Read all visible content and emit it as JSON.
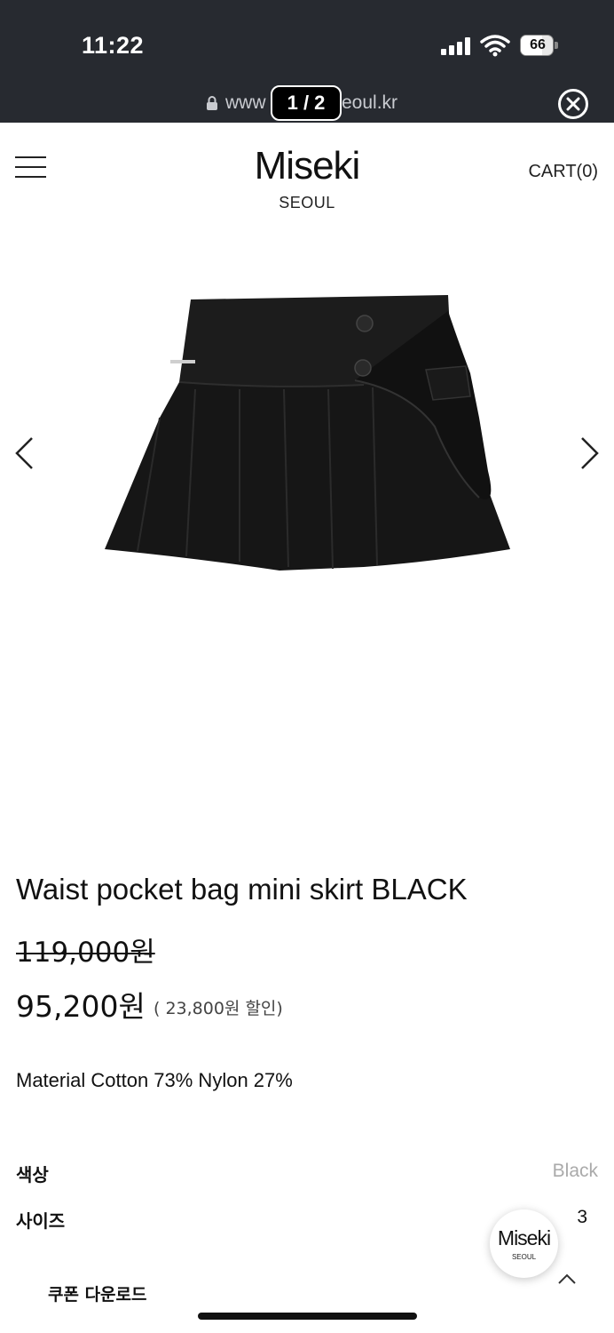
{
  "status_bar": {
    "time": "11:22",
    "battery": "66",
    "battery_level": 0.66
  },
  "browser": {
    "url_left": "www",
    "url_right": "eoul.kr",
    "page_counter": "1 / 2"
  },
  "header": {
    "brand": "Miseki",
    "brand_sub": "SEOUL",
    "cart": "CART(0)"
  },
  "product": {
    "title": "Waist pocket bag mini skirt BLACK",
    "original_price": "119,000원",
    "sale_price": "95,200원",
    "discount": "( 23,800원 할인)",
    "material": "Material Cotton 73% Nylon 27%"
  },
  "options": {
    "color_label": "색상",
    "color_value": "Black",
    "size_label": "사이즈",
    "size_value": "3"
  },
  "floating_button": {
    "title": "Miseki",
    "sub": "SEOUL"
  },
  "coupon": {
    "label": "쿠폰 다운로드"
  },
  "colors": {
    "status_bar_bg": "#272a30",
    "text": "#111111",
    "muted": "#aaaaaa"
  },
  "icons": [
    "signal-icon",
    "wifi-icon",
    "battery-icon",
    "lock-icon",
    "close-icon",
    "menu-icon",
    "chevron-left-icon",
    "chevron-right-icon",
    "chevron-up-icon"
  ]
}
